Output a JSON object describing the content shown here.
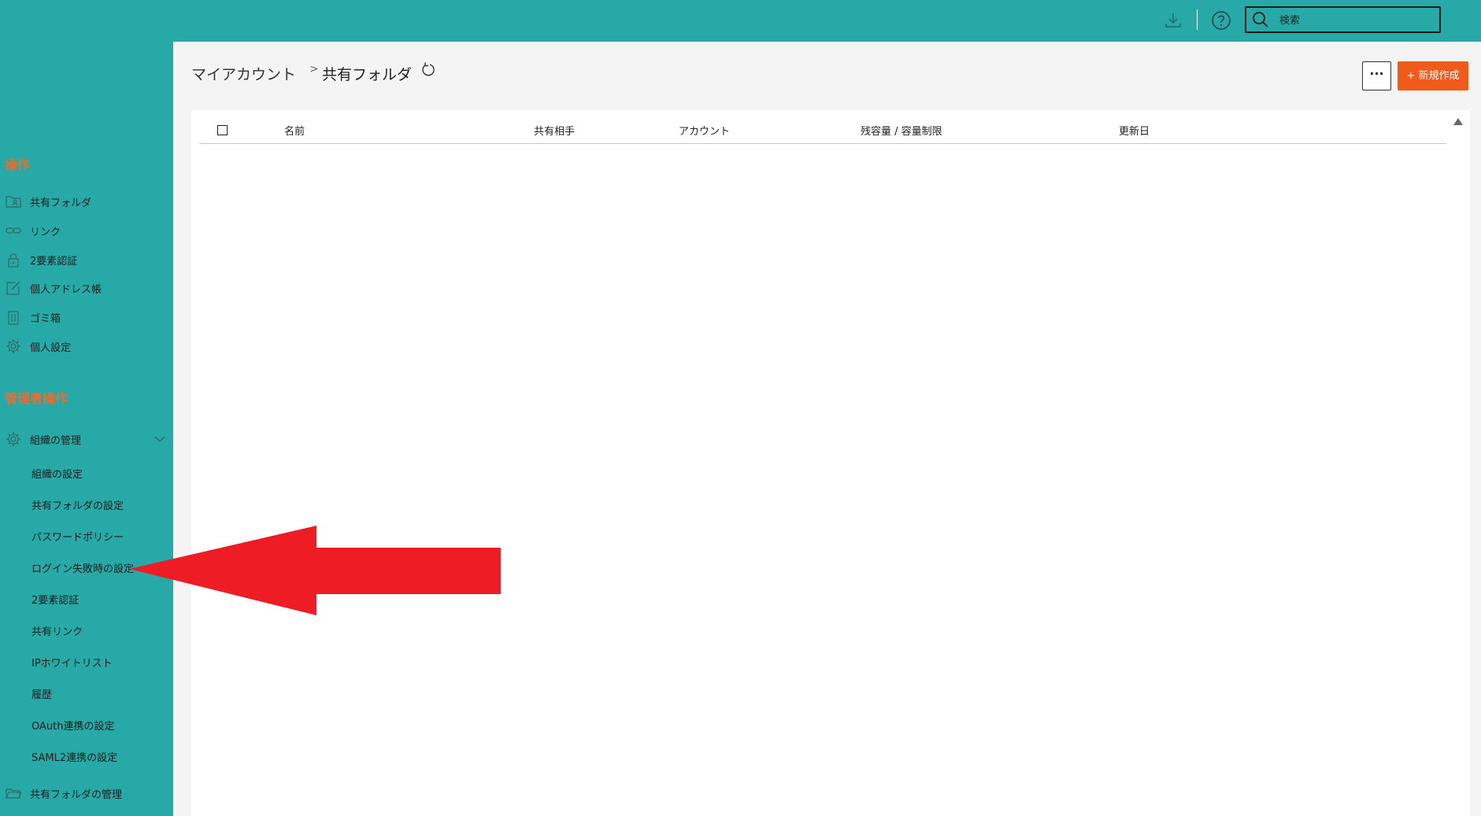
{
  "header": {
    "search_placeholder": "検索",
    "icons": [
      "download-icon",
      "help-icon",
      "search-icon"
    ]
  },
  "sidebar": {
    "section_operations": "操作",
    "operations": [
      {
        "label": "共有フォルダ",
        "icon": "shared-folder-icon"
      },
      {
        "label": "リンク",
        "icon": "link-icon"
      },
      {
        "label": "2要素認証",
        "icon": "lock-icon"
      },
      {
        "label": "個人アドレス帳",
        "icon": "edit-icon"
      },
      {
        "label": "ゴミ箱",
        "icon": "trash-icon"
      },
      {
        "label": "個人設定",
        "icon": "gear-icon"
      }
    ],
    "section_admin": "管理者操作",
    "org_management": {
      "label": "組織の管理",
      "icon": "gear-icon"
    },
    "org_sub_items": [
      "組織の設定",
      "共有フォルダの設定",
      "パスワードポリシー",
      "ログイン失敗時の設定",
      "2要素認証",
      "共有リンク",
      "IPホワイトリスト",
      "履歴",
      "OAuth連携の設定",
      "SAML2連携の設定"
    ],
    "shared_folder_management": {
      "label": "共有フォルダの管理",
      "icon": "folder-icon"
    }
  },
  "main": {
    "breadcrumb_root": "マイアカウント",
    "breadcrumb_separator": ">",
    "breadcrumb_current": "共有フォルダ",
    "more_label": "···",
    "new_button_label": "+ 新規作成",
    "columns": [
      "名前",
      "共有相手",
      "アカウント",
      "残容量 / 容量制限",
      "更新日"
    ]
  },
  "colors": {
    "teal": "#26a9a7",
    "accent_orange": "#f05a1a",
    "section_orange": "#ef6b2b",
    "annotation_red": "#ee1c25"
  }
}
